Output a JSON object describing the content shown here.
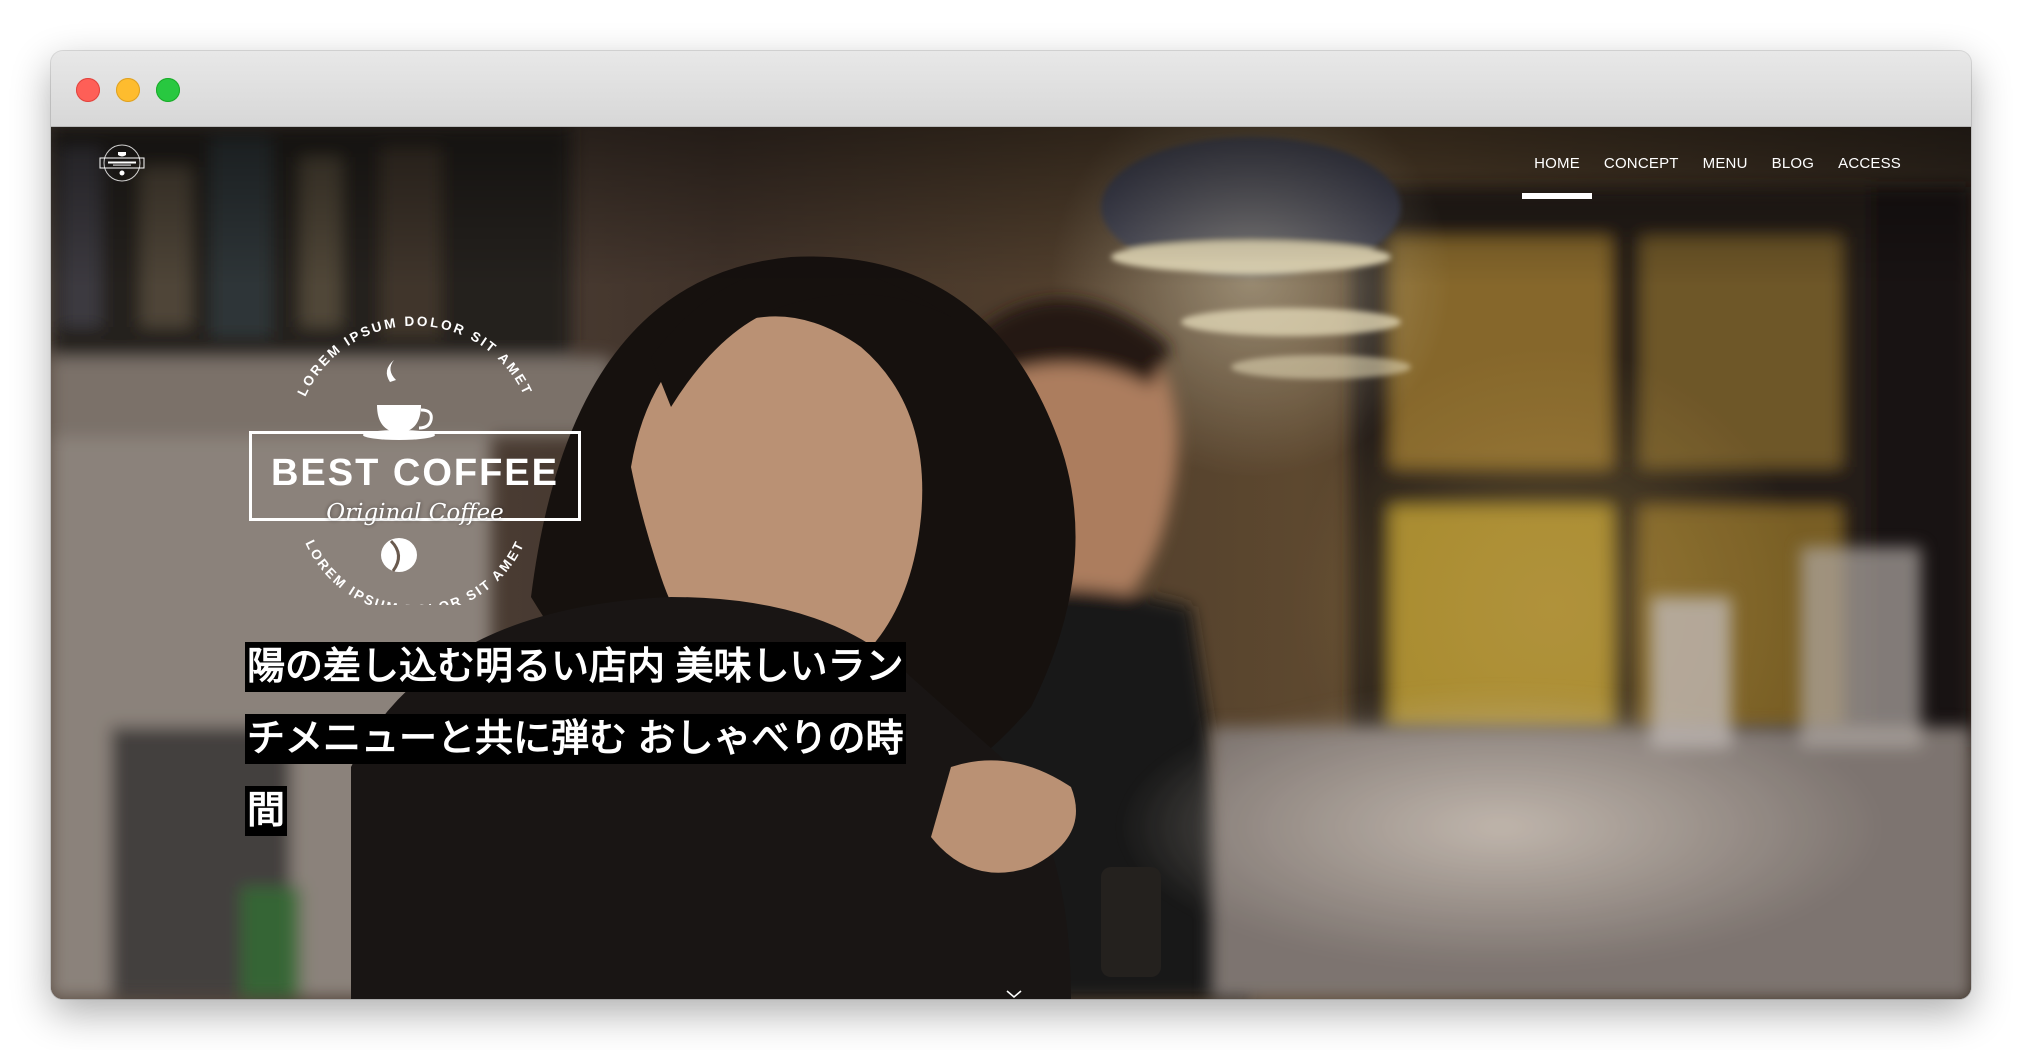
{
  "browser": {
    "buttons": [
      "close",
      "minimize",
      "maximize"
    ]
  },
  "header": {
    "small_logo_icon": "best-coffee-logo",
    "nav": [
      {
        "label": "HOME",
        "active": true
      },
      {
        "label": "CONCEPT",
        "active": false
      },
      {
        "label": "MENU",
        "active": false
      },
      {
        "label": "BLOG",
        "active": false
      },
      {
        "label": "ACCESS",
        "active": false
      }
    ]
  },
  "hero": {
    "emblem": {
      "arc_top": "LOREM IPSUM DOLOR SIT AMET",
      "title": "BEST COFFEE",
      "subtitle": "Original Coffee",
      "arc_bottom": "LOREM IPSUM DOLOR SIT AMET",
      "icons": [
        "coffee-cup-icon",
        "coffee-bean-icon"
      ]
    },
    "tagline": [
      " 陽の差し込む明るい店内 美味しいラン",
      "チメニューと共に弾む おしゃべりの時",
      "間 "
    ],
    "scroll_icon": "chevron-down-icon",
    "colors": {
      "nav_underline": "#ffffff",
      "tagline_bg": "#000000",
      "tagline_text": "#ffffff"
    }
  }
}
